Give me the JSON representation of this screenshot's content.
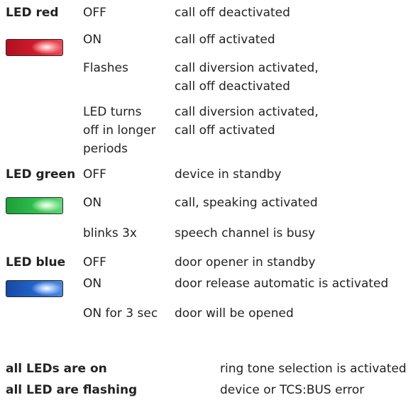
{
  "red": {
    "label": "LED red",
    "rows": [
      {
        "state": "OFF",
        "meaning": "call off deactivated"
      },
      {
        "state": "ON",
        "meaning": "call off activated"
      },
      {
        "state": "Flashes",
        "meaning": "call diversion activated,",
        "meaning2": "call off deactivated"
      },
      {
        "state": "LED turns",
        "state2": "off in longer",
        "state3": "periods",
        "meaning": "call diversion activated,",
        "meaning2": "call off activated"
      }
    ],
    "color": "#d01c2c"
  },
  "green": {
    "label": "LED green",
    "rows": [
      {
        "state": "OFF",
        "meaning": "device in standby"
      },
      {
        "state": "ON",
        "meaning": "call, speaking activated"
      },
      {
        "state": "blinks 3x",
        "meaning": "speech channel is busy"
      }
    ],
    "color": "#2fbf4e"
  },
  "blue": {
    "label": "LED blue",
    "rows": [
      {
        "state": "OFF",
        "meaning": "door opener in standby"
      },
      {
        "state": "ON",
        "meaning": "door release automatic is activated"
      },
      {
        "state": "ON for 3 sec",
        "meaning": "door will be opened"
      }
    ],
    "color": "#2466cc"
  },
  "summary": [
    {
      "label": "all LEDs are on",
      "meaning": "ring tone selection is activated"
    },
    {
      "label": "all LED are flashing",
      "meaning": "device or TCS:BUS error"
    }
  ]
}
